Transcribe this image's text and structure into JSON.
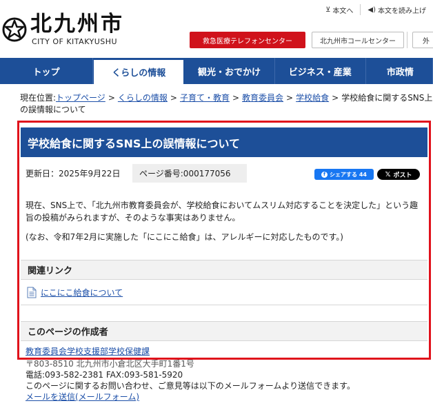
{
  "header": {
    "logo_title": "北九州市",
    "logo_sub": "CITY OF KITAKYUSHU",
    "util": {
      "text_size": "本文へ",
      "read_aloud": "本文を読み上げ"
    },
    "emergency_button": "救急医療テレフォンセンター",
    "call_center_button": "北九州市コールセンター",
    "more_button": "外"
  },
  "nav": {
    "items": [
      "トップ",
      "くらしの情報",
      "観光・おでかけ",
      "ビジネス・産業",
      "市政情"
    ]
  },
  "breadcrumb": {
    "prefix": "現在位置:",
    "links": [
      "トップページ",
      "くらしの情報",
      "子育て・教育",
      "教育委員会",
      "学校給食"
    ],
    "current": "学校給食に関するSNS上の誤情報について"
  },
  "article": {
    "title": "学校給食に関するSNS上の誤情報について",
    "updated": "更新日：2025年9月22日",
    "page_number": "ページ番号:000177056",
    "share_fb": "シェアする 44",
    "share_x": "ポスト",
    "body": "現在、SNS上で、「北九州市教育委員会が、学校給食においてムスリム対応することを決定した」という趣旨の投稿がみられますが、そのような事実はありません。",
    "note": "(なお、令和7年2月に実施した「にこにこ給食」は、アレルギーに対応したものです。)"
  },
  "related": {
    "heading": "関連リンク",
    "link": "にこにこ給食について"
  },
  "author": {
    "heading": "このページの作成者",
    "department": "教育委員会学校支援部学校保健課",
    "address": "〒803-8510 北九州市小倉北区大手町1番1号",
    "phone": "電話:093-582-2381 FAX:093-581-5920",
    "inquiry": "このページに関するお問い合わせ、ご意見等は以下のメールフォームより送信できます。",
    "mail_link": "メールを送信(メールフォーム)"
  },
  "colors": {
    "primary_blue": "#1d4f98",
    "emergency_red": "#d0121b",
    "highlight_red": "#e0111b",
    "link_blue": "#1c4fa8",
    "facebook_blue": "#1877f2"
  },
  "icons": [
    "city-emblem-icon",
    "text-icon",
    "speaker-icon",
    "document-icon",
    "facebook-icon",
    "x-logo-icon"
  ]
}
